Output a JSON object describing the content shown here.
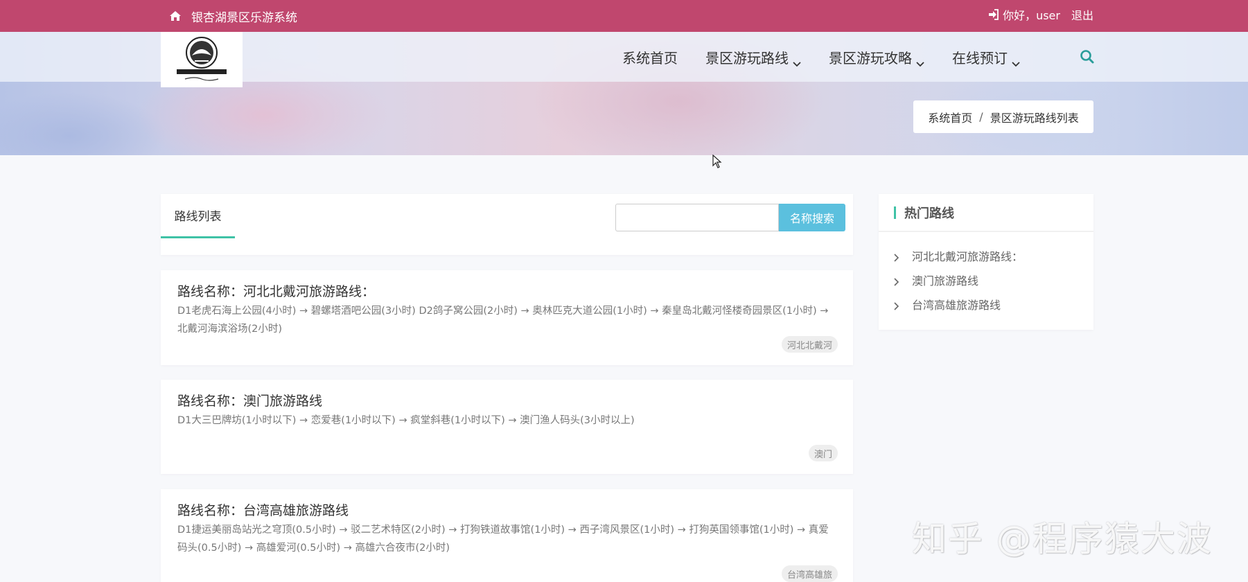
{
  "topbar": {
    "site_title": "银杏湖景区乐游系统",
    "greeting": "你好，user",
    "logout": "退出"
  },
  "nav": {
    "items": [
      {
        "label": "系统首页",
        "dropdown": false
      },
      {
        "label": "景区游玩路线",
        "dropdown": true
      },
      {
        "label": "景区游玩攻略",
        "dropdown": true
      },
      {
        "label": "在线预订",
        "dropdown": true
      }
    ],
    "icons": {
      "search": "search-icon",
      "home": "home-icon"
    }
  },
  "breadcrumb": {
    "home": "系统首页",
    "separator": "/",
    "current": "景区游玩路线列表"
  },
  "list_panel": {
    "tab_label": "路线列表",
    "search_placeholder": "",
    "search_value": "",
    "search_button": "名称搜索"
  },
  "routes": [
    {
      "title": "路线名称：河北北戴河旅游路线：",
      "desc": "D1老虎石海上公园(4小时) → 碧螺塔酒吧公园(3小时) D2鸽子窝公园(2小时) → 奥林匹克大道公园(1小时) → 秦皇岛北戴河怪楼奇园景区(1小时) → 北戴河海滨浴场(2小时)",
      "tag": "河北北戴河"
    },
    {
      "title": "路线名称：澳门旅游路线",
      "desc": "D1大三巴牌坊(1小时以下) → 恋爱巷(1小时以下) → 疯堂斜巷(1小时以下) → 澳门渔人码头(3小时以上)",
      "tag": "澳门"
    },
    {
      "title": "路线名称：台湾高雄旅游路线",
      "desc": "D1捷运美丽岛站光之穹顶(0.5小时) → 驳二艺术特区(2小时) → 打狗铁道故事馆(1小时) → 西子湾风景区(1小时) → 打狗英国领事馆(1小时) → 真爱码头(0.5小时) → 高雄爱河(0.5小时) → 高雄六合夜市(2小时)",
      "tag": "台湾高雄旅"
    }
  ],
  "sidebar": {
    "title": "热门路线",
    "items": [
      "河北北戴河旅游路线：",
      "澳门旅游路线",
      "台湾高雄旅游路线"
    ]
  },
  "watermark": "知乎 @程序猿大波",
  "colors": {
    "topbar": "#c0476e",
    "accent": "#3fc2a6",
    "search_button": "#5bc0de"
  }
}
